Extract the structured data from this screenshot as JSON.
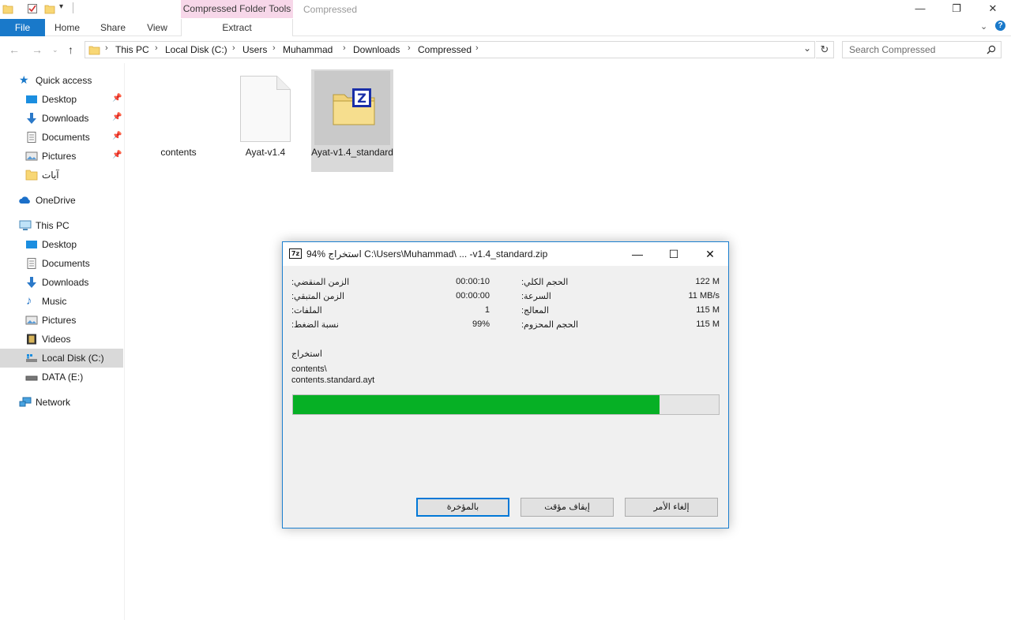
{
  "ribbon": {
    "context_group": "Compressed Folder Tools",
    "window_title": "Compressed",
    "tabs": {
      "file": "File",
      "home": "Home",
      "share": "Share",
      "view": "View",
      "extract": "Extract"
    }
  },
  "address": {
    "crumbs": [
      "This PC",
      "Local Disk (C:)",
      "Users",
      "Muhammad",
      "Downloads",
      "Compressed"
    ]
  },
  "search": {
    "placeholder": "Search Compressed"
  },
  "nav": {
    "quick_access": "Quick access",
    "qa_desktop": "Desktop",
    "qa_downloads": "Downloads",
    "qa_documents": "Documents",
    "qa_pictures": "Pictures",
    "qa_ayat": "آيات",
    "onedrive": "OneDrive",
    "this_pc": "This PC",
    "pc_desktop": "Desktop",
    "pc_documents": "Documents",
    "pc_downloads": "Downloads",
    "pc_music": "Music",
    "pc_pictures": "Pictures",
    "pc_videos": "Videos",
    "local_disk": "Local Disk (C:)",
    "data_drive": "DATA (E:)",
    "network": "Network"
  },
  "files": [
    {
      "name": "contents"
    },
    {
      "name": "Ayat-v1.4"
    },
    {
      "name": "Ayat-v1.4_standard"
    }
  ],
  "dialog": {
    "title": "94% استخراج C:\\Users\\Muhammad\\ ... -v1.4_standard.zip",
    "stats_left": [
      {
        "label": "الزمن المنقضي:",
        "value": "00:00:10"
      },
      {
        "label": "الزمن المتبقي:",
        "value": "00:00:00"
      },
      {
        "label": "الملفات:",
        "value": "1"
      },
      {
        "label": "نسبة الضغط:",
        "value": "99%"
      }
    ],
    "stats_right": [
      {
        "label": "الحجم الكلي:",
        "value": "122 M"
      },
      {
        "label": "السرعة:",
        "value": "11 MB/s"
      },
      {
        "label": "المعالج:",
        "value": "115 M"
      },
      {
        "label": "الحجم المحزوم:",
        "value": "115 M"
      }
    ],
    "operation": "استخراج",
    "path_line1": "contents\\",
    "path_line2": "contents.standard.ayt",
    "progress": 0.86,
    "buttons": {
      "background": "بالمؤخرة",
      "pause": "إيقاف مؤقت",
      "cancel": "إلغاء الأمر"
    }
  },
  "colors": {
    "accent": "#1979ca",
    "progress": "#06b025",
    "context_tab": "#f7d7e9"
  }
}
